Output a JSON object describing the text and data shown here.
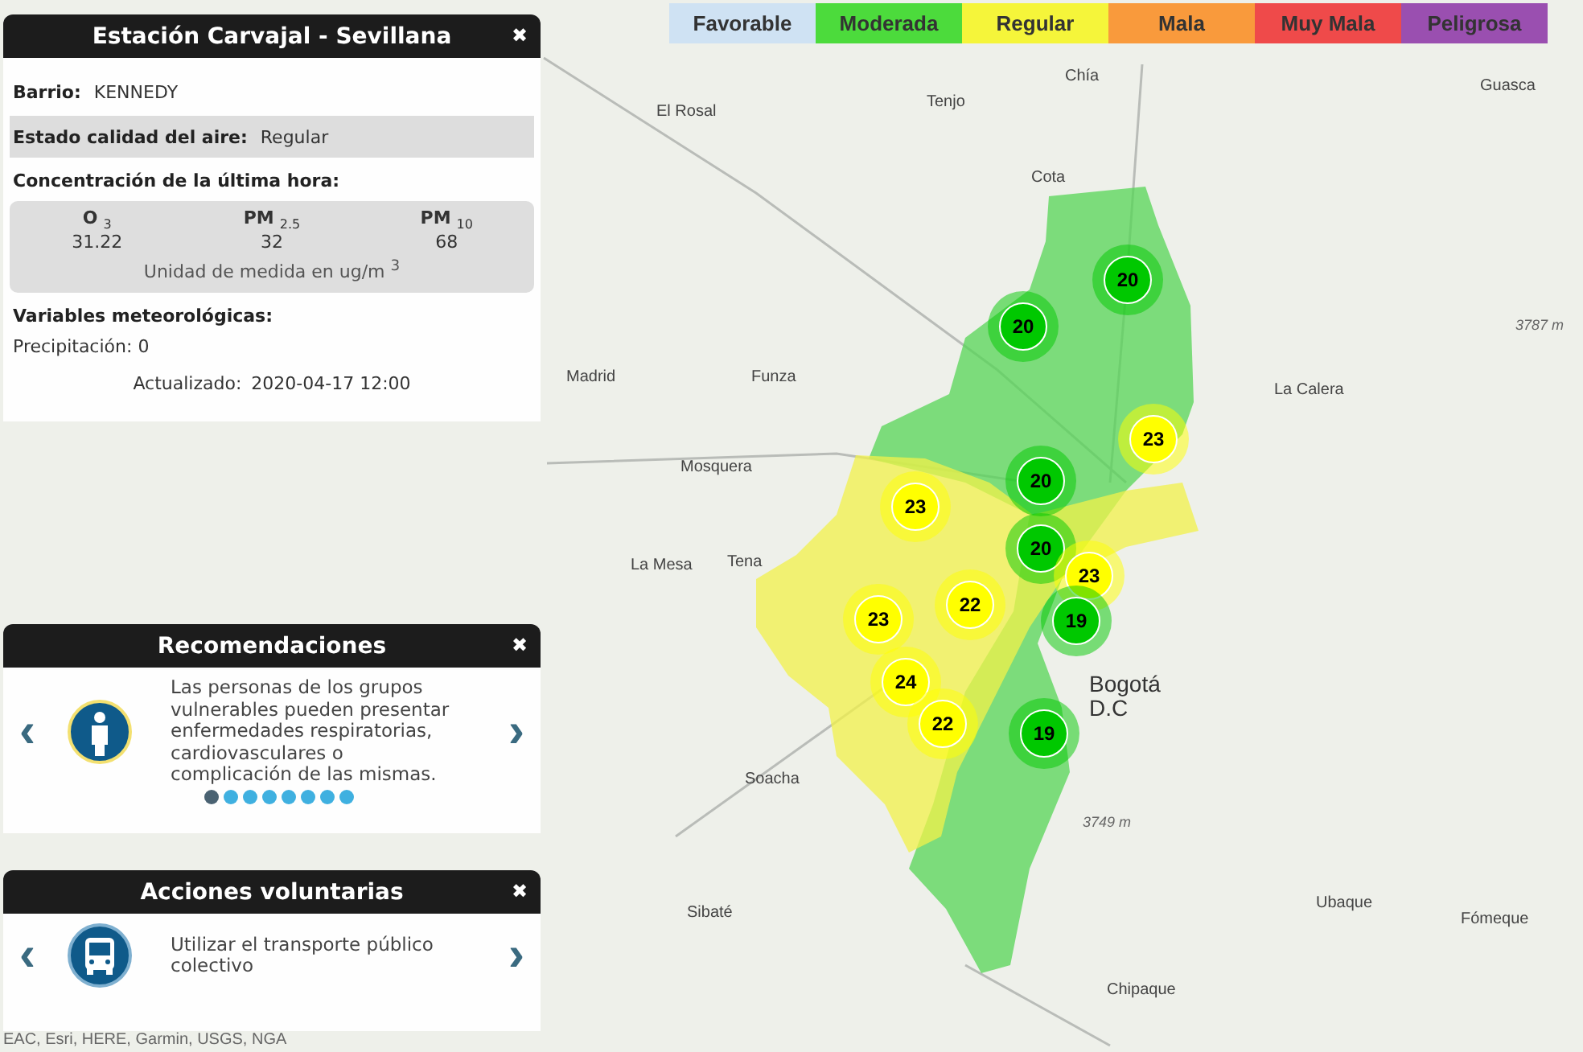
{
  "legend": [
    {
      "label": "Favorable",
      "color": "#cfe2f3"
    },
    {
      "label": "Moderada",
      "color": "#4cdb3c"
    },
    {
      "label": "Regular",
      "color": "#f5f53a"
    },
    {
      "label": "Mala",
      "color": "#f99a3c"
    },
    {
      "label": "Muy Mala",
      "color": "#ef4a4a"
    },
    {
      "label": "Peligrosa",
      "color": "#9a4fb0"
    }
  ],
  "station_panel": {
    "title": "Estación Carvajal - Sevillana",
    "close": "✖",
    "fields": [
      {
        "label": "Barrio:",
        "value": "KENNEDY",
        "highlighted": false
      },
      {
        "label": "Estado calidad del aire:",
        "value": "Regular",
        "highlighted": true
      }
    ],
    "concentration_heading": "Concentración de la última hora:",
    "pollutants": [
      {
        "name": "**O** $_{3}$",
        "value": "31.22"
      },
      {
        "name": "**PM** $_{2.5}$",
        "value": "32"
      },
      {
        "name": "**PM** $_{10}$",
        "value": "68"
      }
    ],
    "unit": "Unidad de medida en ug/m $^{3}$",
    "weather_heading": "Variables meteorológicas:",
    "weather": [
      "Precipitación: 0"
    ],
    "updated_label": "Actualizado:",
    "updated_value": "2020-04-17 12:00"
  },
  "recommendations": {
    "title": "Recomendaciones",
    "close": "✖",
    "prev": "‹",
    "next": "›",
    "kind": "person",
    "text": "Las personas de los grupos vulnerables pueden presentar enfermedades respiratorias, cardiovasculares o complicación de las mismas.",
    "dots": [
      {
        "selected": true
      },
      {
        "selected": false
      },
      {
        "selected": false
      },
      {
        "selected": false
      },
      {
        "selected": false
      },
      {
        "selected": false
      },
      {
        "selected": false
      },
      {
        "selected": false
      }
    ]
  },
  "actions": {
    "title": "Acciones voluntarias",
    "close": "✖",
    "prev": "‹",
    "next": "›",
    "kind": "bus",
    "text": "Utilizar el transporte público colectivo"
  },
  "map": {
    "places": [
      "El Rosal",
      "Tenjo",
      "Chía",
      "Cota",
      "Madrid",
      "Funza",
      "Mosquera",
      "La Calera",
      "Bogotá D.C",
      "Soacha",
      "Sibaté",
      "Chipaque",
      "Ubaque",
      "Fómeque",
      "Guasca",
      "La Mesa",
      "Tena",
      "3749 m",
      "3787 m"
    ],
    "stations": [
      {
        "value": "20",
        "color": "#00c800"
      },
      {
        "value": "20",
        "color": "#00c800"
      },
      {
        "value": "23",
        "color": "#ffff00"
      },
      {
        "value": "20",
        "color": "#00c800"
      },
      {
        "value": "23",
        "color": "#ffff00"
      },
      {
        "value": "20",
        "color": "#00c800"
      },
      {
        "value": "23",
        "color": "#ffff00"
      },
      {
        "value": "22",
        "color": "#ffff00"
      },
      {
        "value": "23",
        "color": "#ffff00"
      },
      {
        "value": "19",
        "color": "#00c800"
      },
      {
        "value": "24",
        "color": "#ffff00"
      },
      {
        "value": "22",
        "color": "#ffff00"
      },
      {
        "value": "19",
        "color": "#00c800"
      }
    ],
    "attribution": "EAC, Esri, HERE, Garmin, USGS, NGA"
  }
}
